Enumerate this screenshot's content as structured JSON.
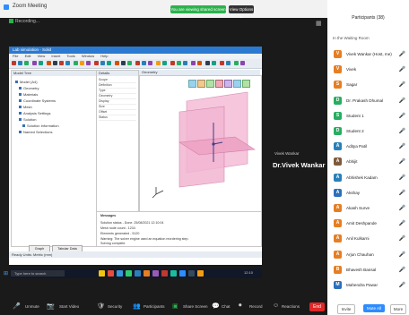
{
  "window": {
    "title": "Zoom Meeting",
    "minimize_glyph": "—",
    "maximize_glyph": "▢",
    "close_glyph": "✕"
  },
  "share_bar": {
    "status": "You are viewing shared screen",
    "options_label": "View Options ▾",
    "brand_color": "#2bb24c"
  },
  "meeting": {
    "status_text": "Recording...",
    "tile_icon": "▦"
  },
  "shared_app": {
    "title_text": "Lab simulation - Solid",
    "menu": [
      "File",
      "Edit",
      "View",
      "Insert",
      "Tools",
      "Window",
      "Help"
    ],
    "tree_header": "Model Tree",
    "tree_items": [
      "Model (A4)",
      "Geometry",
      "Materials",
      "Coordinate Systems",
      "Mesh",
      "Analysis Settings",
      "Solution",
      "Solution Information",
      "Named Selections"
    ],
    "props_header": "Details",
    "props_rows": [
      "Scope",
      "Definition",
      "Type",
      "Geometry",
      "Display",
      "Size",
      "Offset",
      "Status"
    ],
    "graphics_tab": "Geometry",
    "messages": [
      "Messages",
      "Solution status - Done. 25/08/2021 12:10:04",
      "Mesh node count - 1234",
      "Elements generated - 5120",
      "Warning: The solver engine used an equation reordering step.",
      "Solving complete."
    ],
    "buttons": [
      "Graph",
      "Tabular Data"
    ],
    "status_text": "Ready  Units: Metric (mm)"
  },
  "taskbar": {
    "search_placeholder": "Type here to search",
    "clock": "12:10"
  },
  "presenter": {
    "name": "Dr.Vivek Wankar",
    "sub": "Vivek Wankar"
  },
  "participants_panel": {
    "header": "Participants (38)",
    "sub": "In the Waiting Room",
    "items": [
      {
        "initial": "V",
        "name": "Vivek Wankar (Host, me)",
        "color": "#e67e22"
      },
      {
        "initial": "V",
        "name": "Vivek",
        "color": "#e67e22"
      },
      {
        "initial": "S",
        "name": "Sagar",
        "color": "#e67e22"
      },
      {
        "initial": "D",
        "name": "Dr. Prakash Dhumal",
        "color": "#27ae60"
      },
      {
        "initial": "S",
        "name": "Student 1",
        "color": "#27ae60"
      },
      {
        "initial": "D",
        "name": "Student 2",
        "color": "#27ae60"
      },
      {
        "initial": "A",
        "name": "Aditya Patil",
        "color": "#2980b9"
      },
      {
        "initial": "A",
        "name": "Abhijit",
        "color": "#7f5a3b"
      },
      {
        "initial": "A",
        "name": "Abhishek Kadam",
        "color": "#2980b9"
      },
      {
        "initial": "A",
        "name": "Akshay",
        "color": "#2c6fbb"
      },
      {
        "initial": "A",
        "name": "Akash Surve",
        "color": "#e67e22"
      },
      {
        "initial": "A",
        "name": "Amit Deshpande",
        "color": "#e67e22"
      },
      {
        "initial": "A",
        "name": "Anil Kulkarni",
        "color": "#e67e22"
      },
      {
        "initial": "A",
        "name": "Arjun Chauhan",
        "color": "#e67e22"
      },
      {
        "initial": "B",
        "name": "Bhavesh Bansal",
        "color": "#e67e22"
      },
      {
        "initial": "M",
        "name": "Mahendra Pawar",
        "color": "#2c6fbb"
      }
    ],
    "invite_label": "Invite",
    "mute_all_label": "Mute All",
    "more_label": "More"
  },
  "bottom_toolbar": {
    "unmute": "Unmute",
    "video": "Start Video",
    "security": "Security",
    "participants": "Participants",
    "chat": "Chat",
    "share": "Share Screen",
    "record": "Record",
    "reactions": "Reactions",
    "end": "End",
    "accent_end": "#e02828"
  }
}
